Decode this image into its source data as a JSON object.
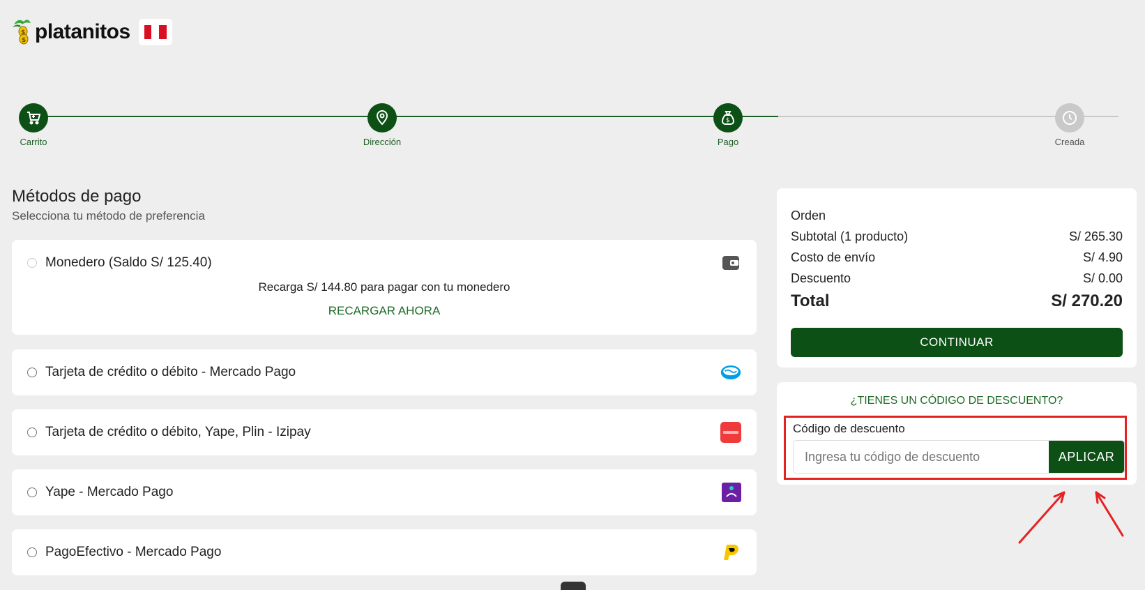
{
  "brand": {
    "name": "platanitos",
    "country_flag": "Perú",
    "accent_color": "#0c5015"
  },
  "steps": [
    {
      "label": "Carrito",
      "state": "done",
      "icon": "cart-icon"
    },
    {
      "label": "Dirección",
      "state": "done",
      "icon": "location-pin-icon"
    },
    {
      "label": "Pago",
      "state": "active",
      "icon": "money-bag-icon"
    },
    {
      "label": "Creada",
      "state": "pending",
      "icon": "clock-icon"
    }
  ],
  "payment": {
    "title": "Métodos de pago",
    "subtitle": "Selecciona tu método de preferencia",
    "wallet": {
      "label": "Monedero (Saldo S/ 125.40)",
      "message": "Recarga S/ 144.80 para pagar con tu monedero",
      "action": "RECARGAR AHORA",
      "icon": "wallet-icon"
    },
    "options": [
      {
        "label": "Tarjeta de crédito o débito - Mercado Pago",
        "icon": "mercadopago-icon"
      },
      {
        "label": "Tarjeta de crédito o débito, Yape, Plin - Izipay",
        "icon": "izipay-icon"
      },
      {
        "label": "Yape - Mercado Pago",
        "icon": "yape-icon"
      },
      {
        "label": "PagoEfectivo - Mercado Pago",
        "icon": "pagoefectivo-icon"
      }
    ]
  },
  "order": {
    "heading": "Orden",
    "rows": [
      {
        "label": "Subtotal (1 producto)",
        "value": "S/ 265.30"
      },
      {
        "label": "Costo de envío",
        "value": "S/ 4.90"
      },
      {
        "label": "Descuento",
        "value": "S/ 0.00"
      }
    ],
    "total_label": "Total",
    "total_value": "S/ 270.20",
    "continue_label": "CONTINUAR"
  },
  "discount": {
    "title": "¿TIENES UN CÓDIGO DE DESCUENTO?",
    "field_label": "Código de descuento",
    "placeholder": "Ingresa tu código de descuento",
    "value": "",
    "apply_label": "APLICAR",
    "highlight_color": "#e52121"
  }
}
